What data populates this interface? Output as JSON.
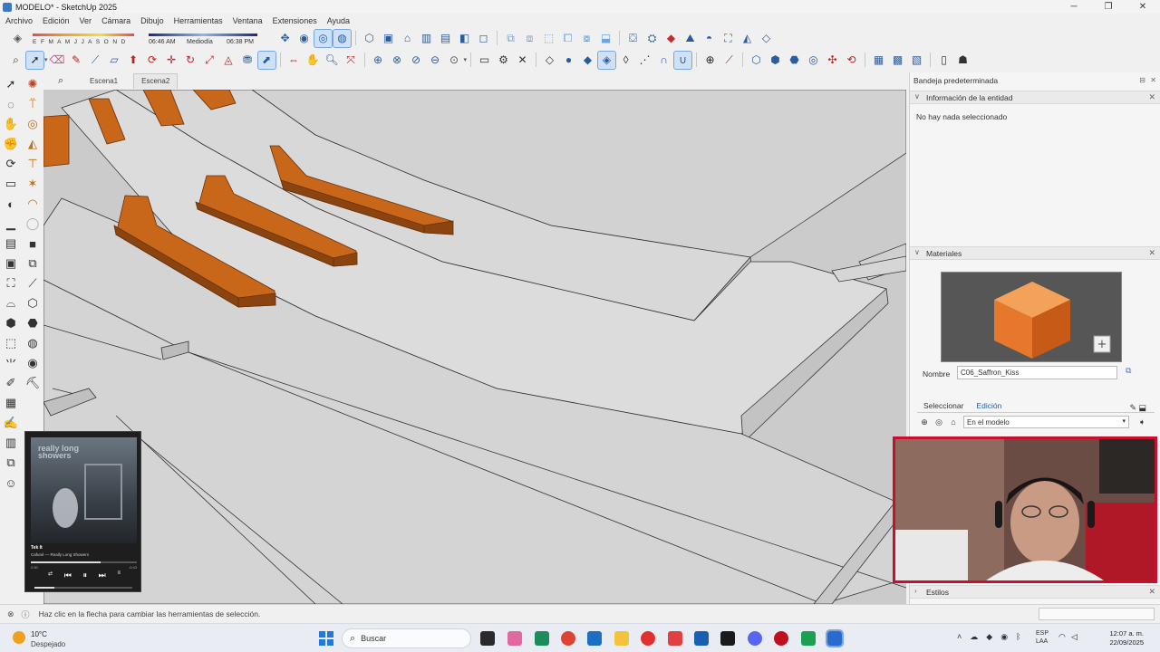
{
  "window": {
    "title": "MODELO* - SketchUp 2025",
    "controls": [
      "minimize",
      "restore",
      "close"
    ]
  },
  "menu": [
    "Archivo",
    "Edición",
    "Ver",
    "Cámara",
    "Dibujo",
    "Herramientas",
    "Ventana",
    "Extensiones",
    "Ayuda"
  ],
  "shadows": {
    "months": "E F M A M J J A S O N D",
    "sunrise": "06:46 AM",
    "midday": "Mediodía",
    "sunset": "06:38 PM"
  },
  "scenes": {
    "tabs": [
      "Escena1",
      "Escena2"
    ],
    "active": "Escena2"
  },
  "tray": {
    "title": "Bandeja predeterminada",
    "entity_info": {
      "header": "Información de la entidad",
      "message": "No hay nada seleccionado"
    },
    "materials": {
      "header": "Materiales",
      "name_label": "Nombre",
      "name_value": "C06_Saffron_Kiss",
      "tab_select": "Seleccionar",
      "tab_edit": "Edición",
      "collection": "En el modelo",
      "swatch_color": "#e8772e"
    },
    "styles": {
      "header": "Estilos"
    }
  },
  "music": {
    "album_art_text": "really long showers",
    "song": "Tek It",
    "artist": "Cafuné — Really Long Showers",
    "elapsed": "2:50",
    "remaining": "-0:43",
    "progress": 0.66,
    "volume": 0.2
  },
  "statusbar": {
    "message": "Haz clic en la flecha para cambiar las herramientas de selección."
  },
  "taskbar": {
    "weather_temp": "10°C",
    "weather_desc": "Despejado",
    "search_placeholder": "Buscar",
    "lang_line1": "ESP",
    "lang_line2": "LAA",
    "time": "12:07 a. m.",
    "date": "22/09/2025"
  },
  "colors": {
    "wood": "#c8661a",
    "wood_dark": "#8a4410",
    "concrete": "#d9d9d9",
    "accent": "#2a5d9f",
    "webcam_border": "#c8102e"
  }
}
